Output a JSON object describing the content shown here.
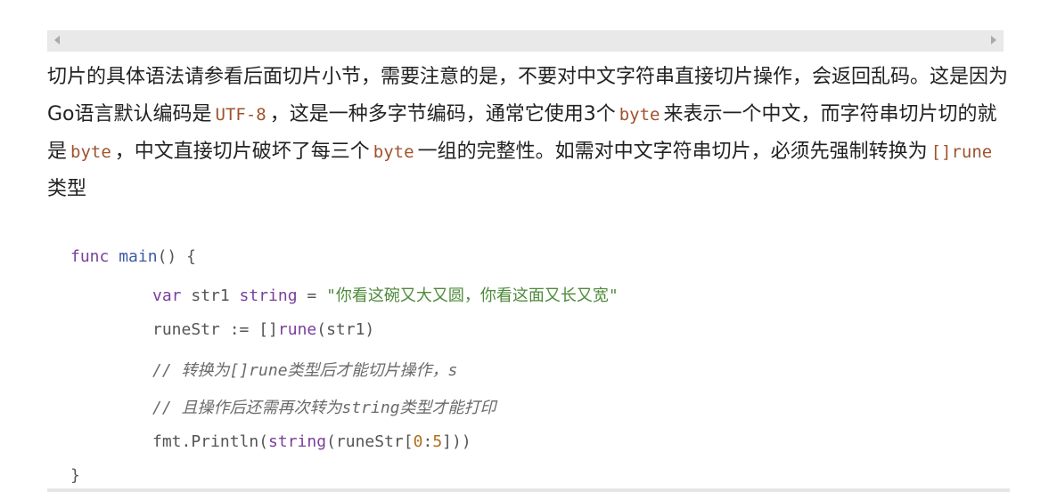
{
  "paragraph": {
    "t1": "切片的具体语法请参看后面切片小节，需要注意的是，不要对中文字符串直接切片操作，会返回乱码。这是因为Go语言默认编码是",
    "c1": "UTF-8",
    "t2": "，这是一种多字节编码，通常它使用3个",
    "c2": "byte",
    "t3": "来表示一个中文，而字符串切片切的就是",
    "c3": "byte",
    "t4": "，中文直接切片破坏了每三个",
    "c4": "byte",
    "t5": "一组的完整性。如需对中文字符串切片，必须先强制转换为",
    "c5": "[]rune",
    "t6": "类型"
  },
  "code": {
    "l1_kw": "func",
    "l1_fn": "main",
    "l1_rest": "() {",
    "l2_kw1": "var",
    "l2_id": " str1 ",
    "l2_kw2": "string",
    "l2_op": " = ",
    "l2_str": "\"你看这碗又大又圆，你看这面又长又宽\"",
    "l3_id": "runeStr := []",
    "l3_kw": "rune",
    "l3_rest": "(str1)",
    "l4_cmt": "// 转换为[]rune类型后才能切片操作，s",
    "l5_cmt": "// 且操作后还需再次转为string类型才能打印",
    "l6_a": "fmt.Println(",
    "l6_kw": "string",
    "l6_b": "(runeStr[",
    "l6_n1": "0",
    "l6_c": ":",
    "l6_n2": "5",
    "l6_d": "]))",
    "l7": "}"
  }
}
